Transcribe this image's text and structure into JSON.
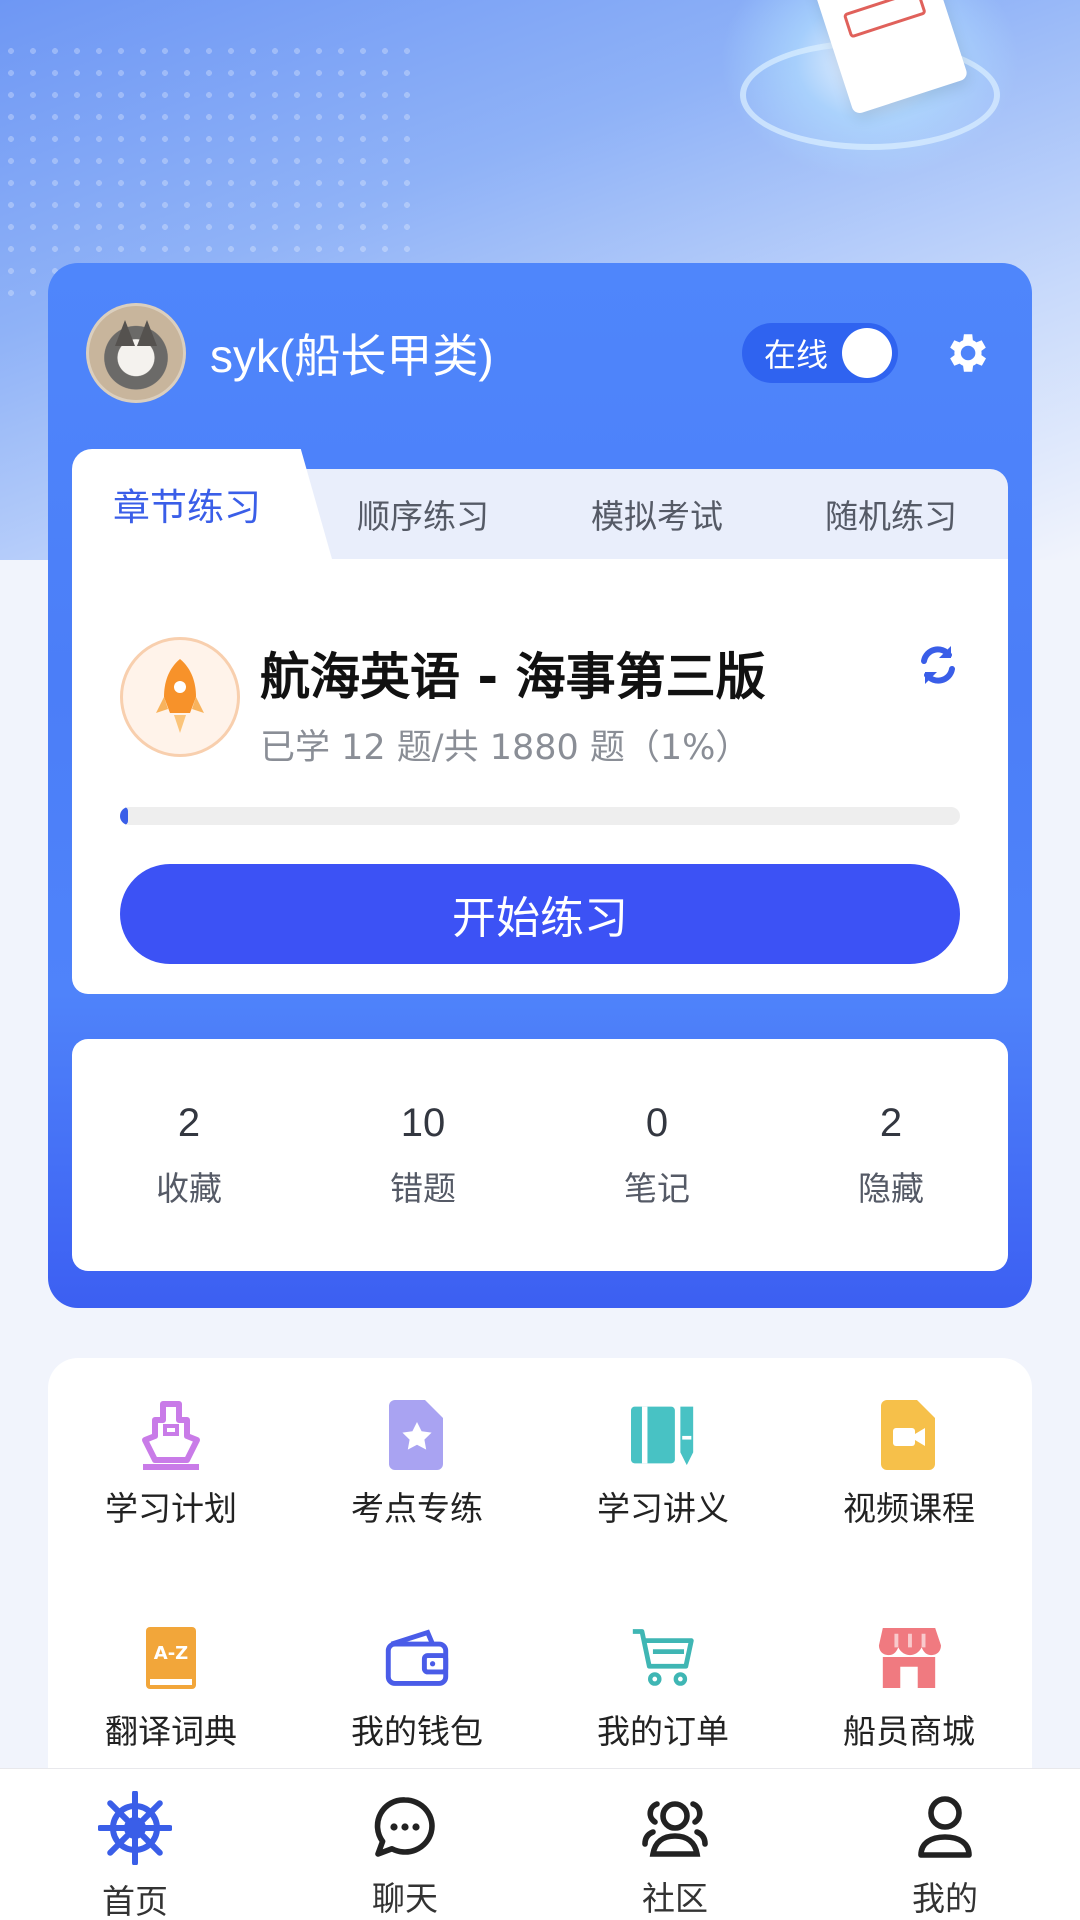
{
  "user": {
    "name": "syk(船长甲类)",
    "status_label": "在线"
  },
  "tabs": [
    "章节练习",
    "顺序练习",
    "模拟考试",
    "随机练习"
  ],
  "active_tab": "章节练习",
  "course": {
    "title": "航海英语 - 海事第三版",
    "progress_text": "已学 12 题/共 1880 题（1%）",
    "progress_fraction": 0.01,
    "start_label": "开始练习"
  },
  "stats": [
    {
      "value": "2",
      "label": "收藏"
    },
    {
      "value": "10",
      "label": "错题"
    },
    {
      "value": "0",
      "label": "笔记"
    },
    {
      "value": "2",
      "label": "隐藏"
    }
  ],
  "menu": [
    {
      "label": "学习计划",
      "icon": "ship-icon",
      "color": "#c97be8"
    },
    {
      "label": "考点专练",
      "icon": "star-file-icon",
      "color": "#a9a3f2"
    },
    {
      "label": "学习讲义",
      "icon": "notebook-pen-icon",
      "color": "#48c2c4"
    },
    {
      "label": "视频课程",
      "icon": "video-file-icon",
      "color": "#f6c04a"
    },
    {
      "label": "翻译词典",
      "icon": "dictionary-icon",
      "color": "#f2a63a"
    },
    {
      "label": "我的钱包",
      "icon": "wallet-icon",
      "color": "#4a5ce8"
    },
    {
      "label": "我的订单",
      "icon": "cart-icon",
      "color": "#3fb6b4"
    },
    {
      "label": "船员商城",
      "icon": "store-icon",
      "color": "#f07a80"
    }
  ],
  "nav": [
    {
      "label": "首页",
      "icon": "helm-wheel-icon",
      "active": true
    },
    {
      "label": "聊天",
      "icon": "chat-icon",
      "active": false
    },
    {
      "label": "社区",
      "icon": "community-icon",
      "active": false
    },
    {
      "label": "我的",
      "icon": "user-icon",
      "active": false
    }
  ],
  "colors": {
    "primary": "#3c52f5",
    "card_blue": "#4f86fb",
    "accent_text": "#3a5ee8"
  }
}
